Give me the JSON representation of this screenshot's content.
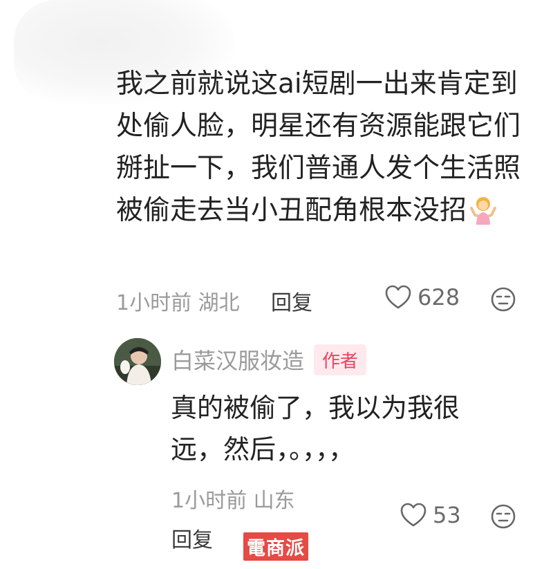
{
  "comment": {
    "text": "我之前就说这ai短剧一出来肯定到处偷人脸，明星还有资源能跟它们掰扯一下，我们普通人发个生活照被偷走去当小丑配角根本没招",
    "emoji": "person-shrugging-emoji",
    "time_location": "1小时前 湖北",
    "reply_label": "回复",
    "likes": "628"
  },
  "reply": {
    "username": "白菜汉服妆造",
    "badge": "作者",
    "text": "真的被偷了，我以为我很远，然后，。，，，",
    "time_location": "1小时前 山东",
    "likes": "53",
    "reply_label": "回复"
  },
  "icons": {
    "like": "heart-outline-icon",
    "dislike": "unamused-face-icon"
  },
  "colors": {
    "badge_bg": "#fde9ee",
    "badge_text": "#e8455f",
    "watermark_bg": "#e54a44"
  },
  "watermark": "電商派"
}
